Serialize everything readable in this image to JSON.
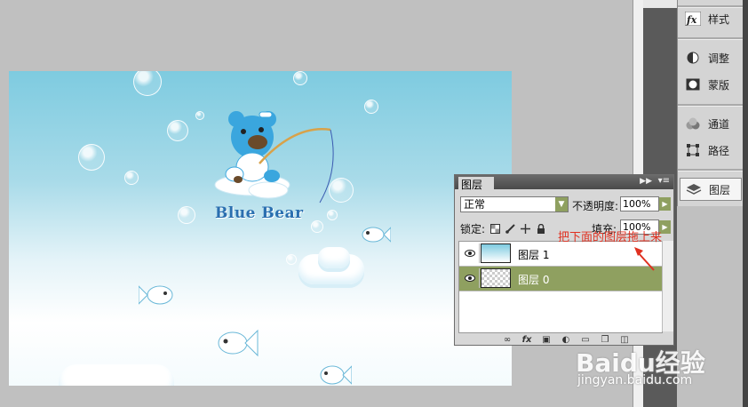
{
  "canvas": {
    "title_text": "Blue Bear"
  },
  "dock": {
    "items": [
      {
        "label": "样式",
        "icon": "fx-icon"
      },
      {
        "label": "调整",
        "icon": "adjust-icon"
      },
      {
        "label": "蒙版",
        "icon": "mask-icon"
      },
      {
        "label": "通道",
        "icon": "channels-icon"
      },
      {
        "label": "路径",
        "icon": "paths-icon"
      },
      {
        "label": "图层",
        "icon": "layers-icon",
        "active": true
      }
    ]
  },
  "layers_panel": {
    "tab_label": "图层",
    "blend_mode": "正常",
    "opacity_label": "不透明度:",
    "opacity_value": "100%",
    "lock_label": "锁定:",
    "fill_label": "填充:",
    "fill_value": "100%",
    "layers": [
      {
        "name": "图层 1",
        "selected": false
      },
      {
        "name": "图层 0",
        "selected": true
      }
    ]
  },
  "annotation": "把下面的图层拖上来",
  "watermark": {
    "text": "Baidu经验",
    "url": "jingyan.baidu.com"
  },
  "colors": {
    "selected_layer": "#8fa060",
    "annotation": "#e03020"
  }
}
